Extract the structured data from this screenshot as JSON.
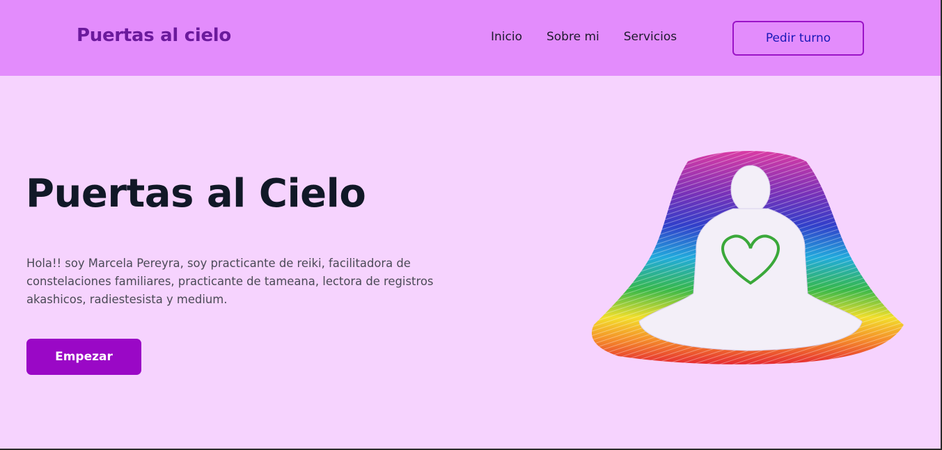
{
  "header": {
    "brand": "Puertas al cielo",
    "nav": [
      "Inicio",
      "Sobre mi",
      "Servicios"
    ],
    "cta_label": "Pedir turno"
  },
  "hero": {
    "title": "Puertas al Cielo",
    "intro": "Hola!! soy Marcela Pereyra, soy practicante de reiki, facilitadora de constelaciones familiares, practicante de tameana, lectora de registros akashicos, radiestesista y medium.",
    "button_label": "Empezar"
  },
  "colors": {
    "header_bg": "#e38cfc",
    "page_bg": "#f6d3fe",
    "brand": "#6b1a9c",
    "accent": "#9a08c6",
    "heading": "#111827"
  }
}
